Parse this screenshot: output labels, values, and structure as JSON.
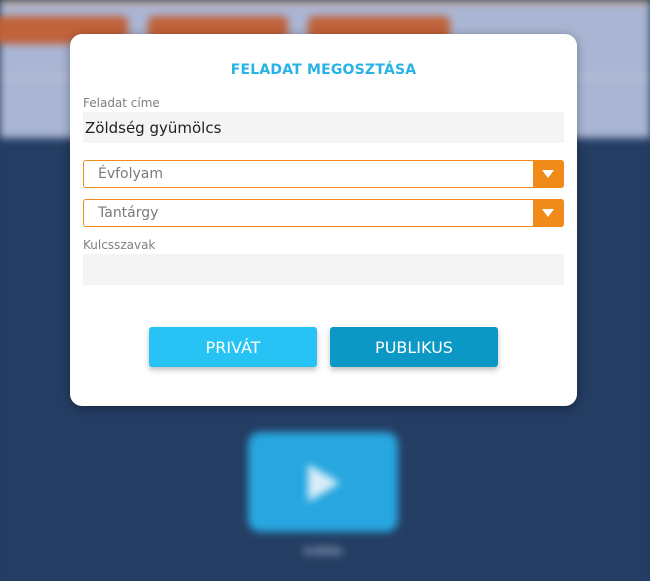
{
  "background": {
    "caption": "Indítás"
  },
  "modal": {
    "title": "FELADAT MEGOSZTÁSA",
    "task_title_label": "Feladat címe",
    "task_title_value": "Zöldség gyümölcs",
    "grade_select": {
      "placeholder": "Évfolyam"
    },
    "subject_select": {
      "placeholder": "Tantárgy"
    },
    "keywords_label": "Kulcsszavak",
    "keywords_value": "",
    "private_button": "PRIVÁT",
    "public_button": "PUBLIKUS"
  },
  "colors": {
    "accent": "#27b3e6",
    "select_border": "#f08a18",
    "private_button": "#26c3f4",
    "public_button": "#0c98c4",
    "backdrop": "#243d63"
  },
  "icons": {
    "dropdown": "chevron-down-icon",
    "play": "play-icon"
  }
}
